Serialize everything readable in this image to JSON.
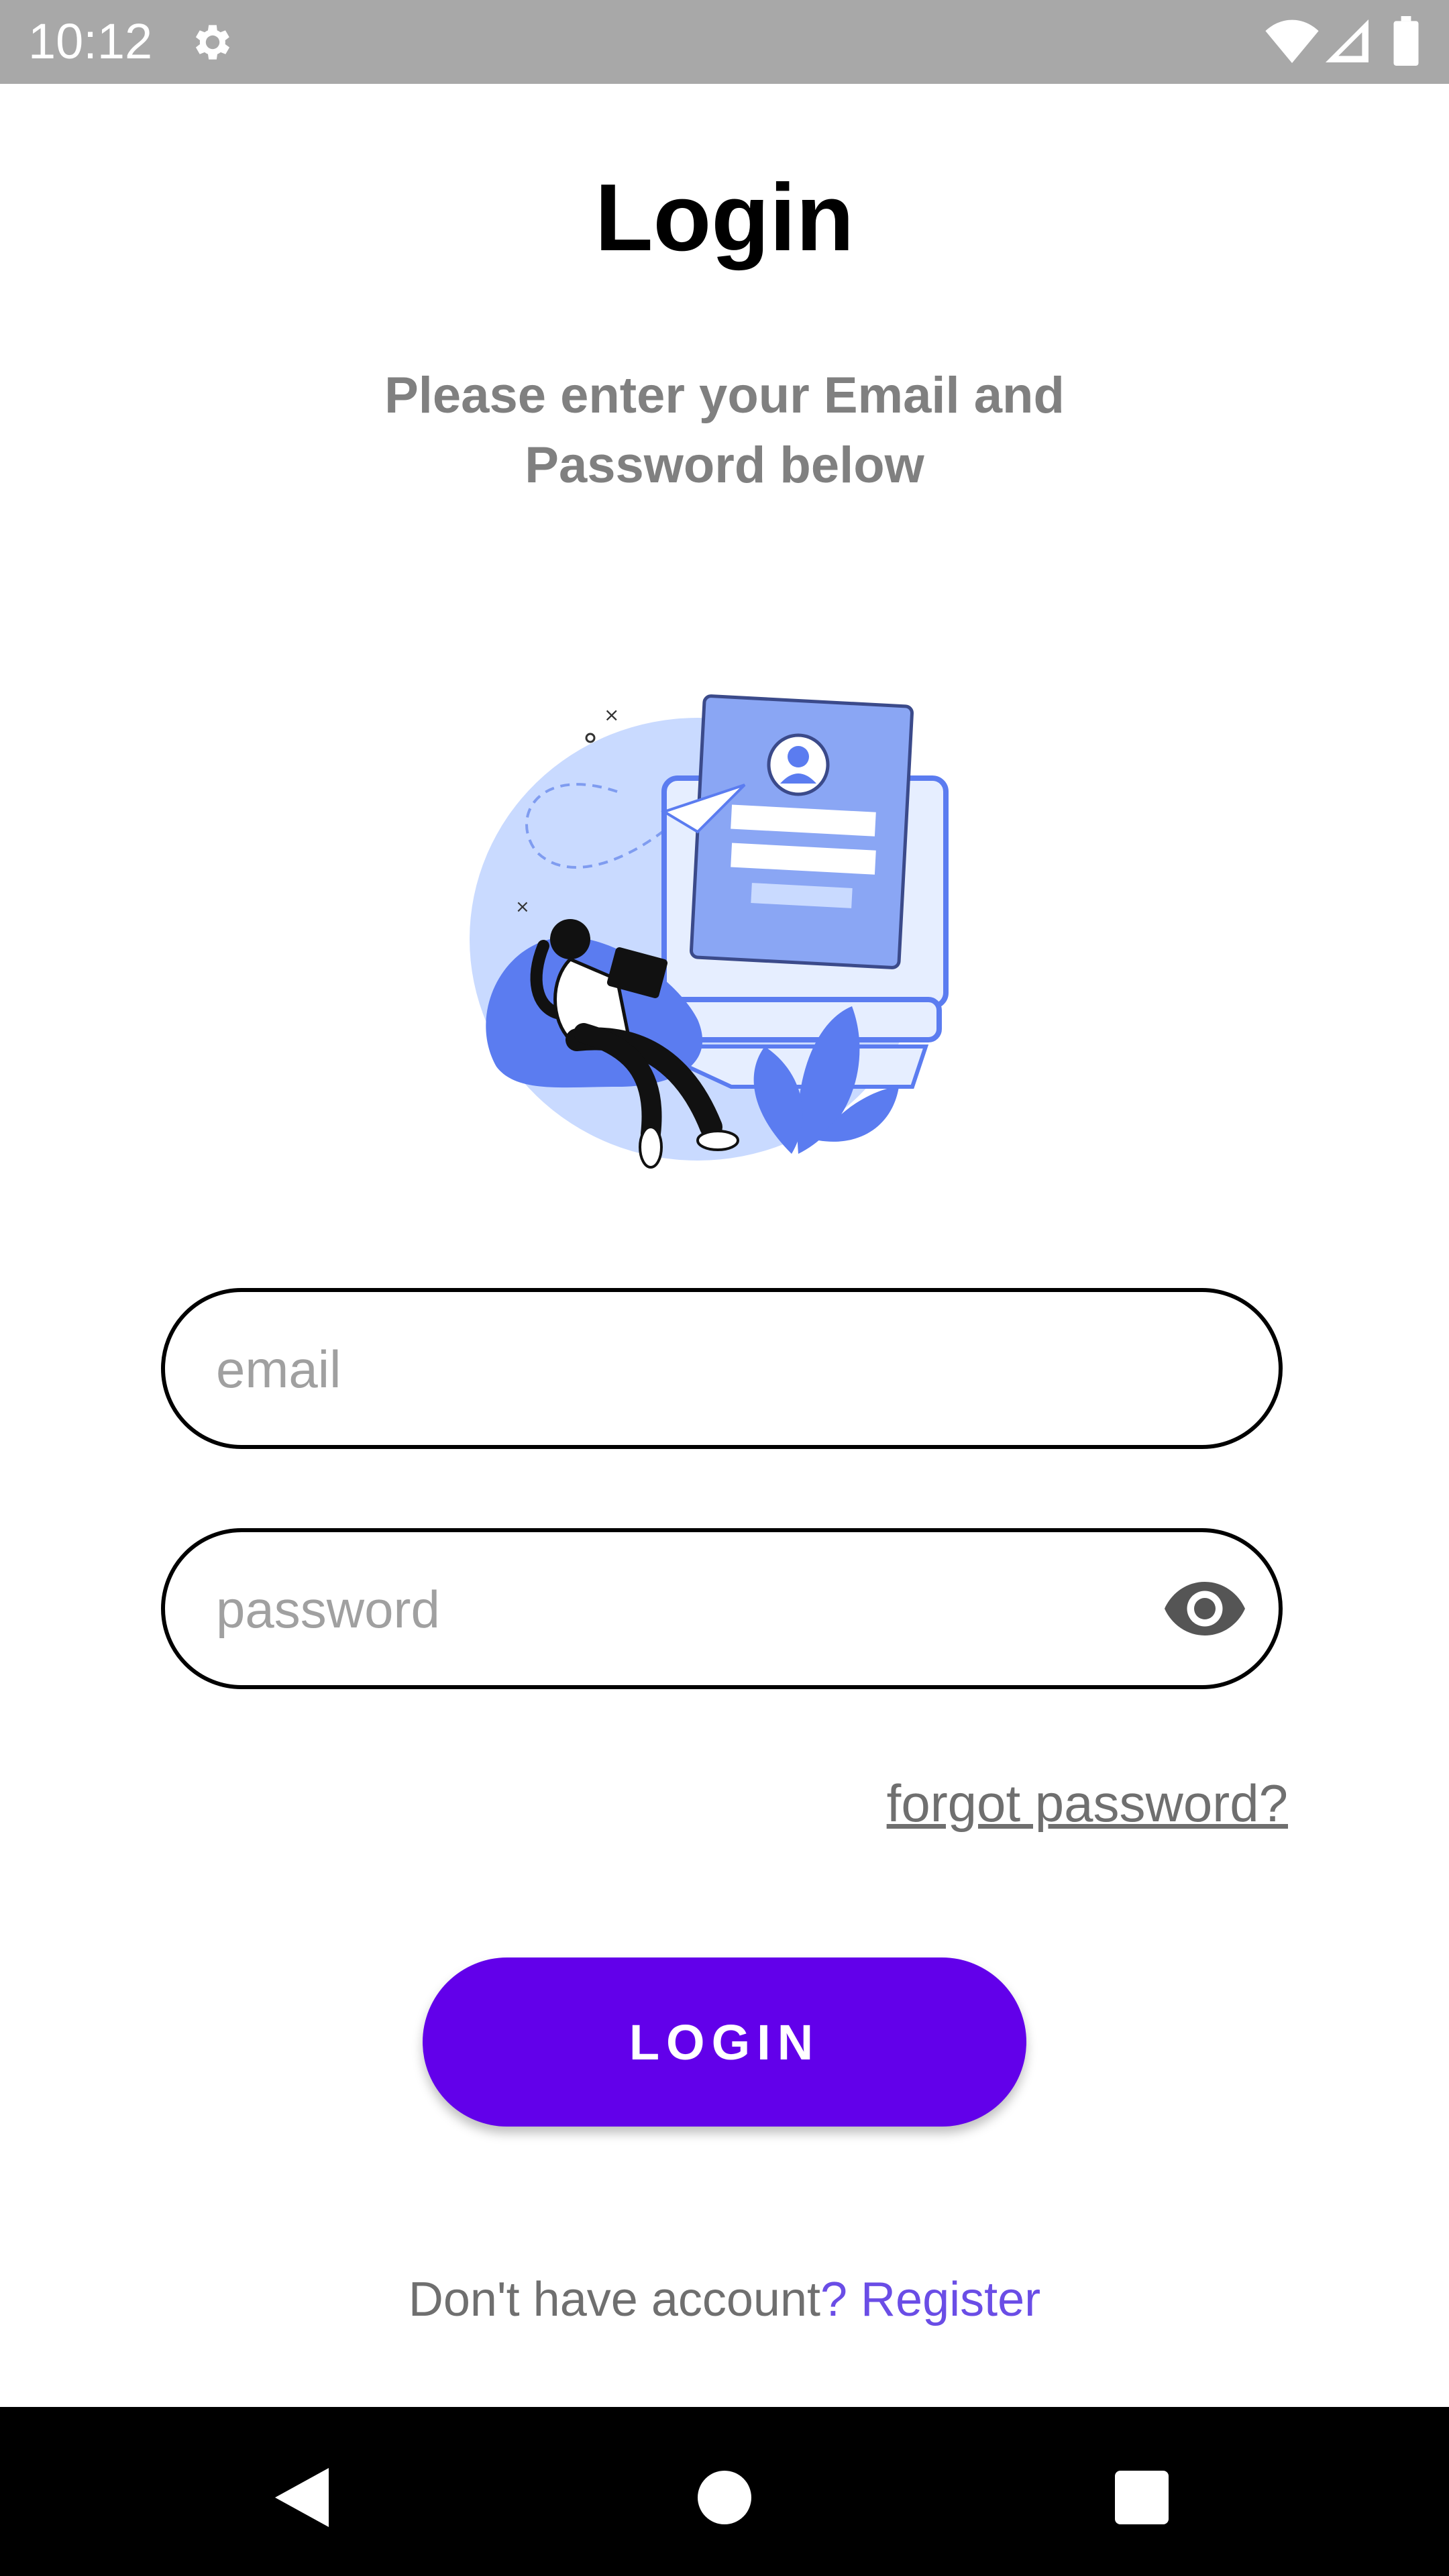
{
  "status_bar": {
    "time": "10:12",
    "icons": [
      "gear-icon",
      "wifi-icon",
      "signal-icon",
      "battery-icon"
    ]
  },
  "screen": {
    "title": "Login",
    "subtitle": "Please enter your Email and Password below"
  },
  "form": {
    "email_placeholder": "email",
    "password_placeholder": "password",
    "password_toggle_icon": "eye-icon",
    "forgot_password": "forgot password?",
    "login_button": "LOGIN"
  },
  "footer": {
    "prompt": "Don't have account",
    "link": "? Register"
  },
  "nav_bar": {
    "icons": [
      "back-icon",
      "home-icon",
      "recents-icon"
    ]
  },
  "colors": {
    "accent": "#6200ea",
    "link": "#6a4de6",
    "status_bar": "#a8a8a8",
    "subtitle": "#808080",
    "illustration_blue": "#5b7cf0"
  }
}
